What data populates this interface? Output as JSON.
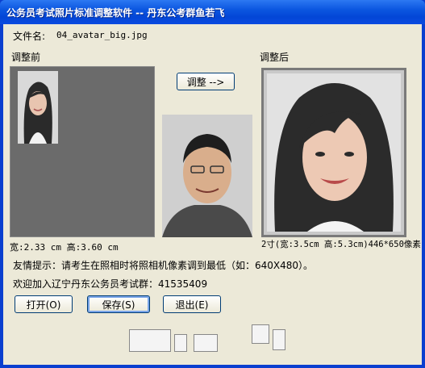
{
  "window": {
    "title": "公务员考试照片标准调整软件 -- 丹东公考群鱼若飞"
  },
  "file": {
    "label": "文件名:",
    "name": "04_avatar_big.jpg"
  },
  "before": {
    "label": "调整前",
    "size_text": "宽:2.33 cm 高:3.60 cm"
  },
  "after": {
    "label": "调整后",
    "size_text": "2寸(宽:3.5cm 高:5.3cm)446*650像素"
  },
  "adjust_button": "调整 -->",
  "tips": {
    "line1": "友情提示：请考生在照相时将照相机像素调到最低（如：640X480）。",
    "line2": "欢迎加入辽宁丹东公务员考试群：41535409"
  },
  "buttons": {
    "open": "打开(O)",
    "save": "保存(S)",
    "exit": "退出(E)"
  },
  "colors": {
    "title_bar": "#0a4ae0",
    "client_bg": "#ece9d8",
    "panel_gray": "#6b6b6b"
  }
}
